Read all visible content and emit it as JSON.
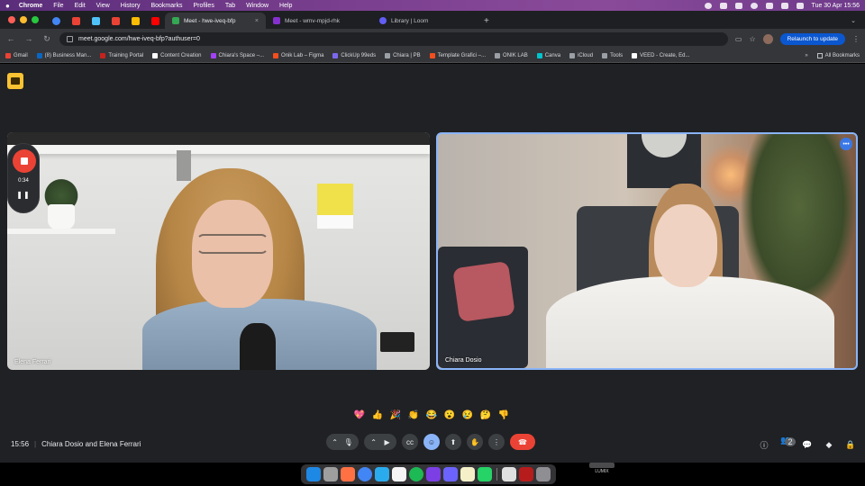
{
  "menubar": {
    "app": "Chrome",
    "items": [
      "File",
      "Edit",
      "View",
      "History",
      "Bookmarks",
      "Profiles",
      "Tab",
      "Window",
      "Help"
    ],
    "datetime": "Tue 30 Apr  15:56"
  },
  "tabs": [
    {
      "label": "Meet - hwe-iveq-bfp",
      "active": true,
      "color": "#34a853"
    },
    {
      "label": "Meet - wmv-mpjd-rhk",
      "active": false,
      "color": "#8430ce"
    },
    {
      "label": "Library | Loom",
      "active": false,
      "color": "#625df5"
    }
  ],
  "toolbar": {
    "url": "meet.google.com/hwe-iveq-bfp?authuser=0",
    "relaunch_label": "Relaunch to update"
  },
  "bookmarks": {
    "items": [
      {
        "label": "Gmail",
        "color": "#ea4335"
      },
      {
        "label": "(8) Business Man...",
        "color": "#0a66c2"
      },
      {
        "label": "Training Portal",
        "color": "#c5221f"
      },
      {
        "label": "Content Creation",
        "color": "#ffffff"
      },
      {
        "label": "Chiara's Space –...",
        "color": "#a142f4"
      },
      {
        "label": "Onik Lab – Figma",
        "color": "#f24e1e"
      },
      {
        "label": "ClickUp 99eds",
        "color": "#7b68ee"
      },
      {
        "label": "Chiara | PB",
        "color": "#9aa0a6"
      },
      {
        "label": "Template Grafici –...",
        "color": "#f24e1e"
      },
      {
        "label": "ONIK LAB",
        "color": "#9aa0a6"
      },
      {
        "label": "Canva",
        "color": "#00c4cc"
      },
      {
        "label": "iCloud",
        "color": "#9aa0a6"
      },
      {
        "label": "Tools",
        "color": "#9aa0a6"
      },
      {
        "label": "VEED - Create, Ed...",
        "color": "#ffffff"
      }
    ],
    "all_label": "All Bookmarks"
  },
  "recording": {
    "elapsed": "0:34"
  },
  "participants": {
    "left": {
      "name": "Elena Ferrari"
    },
    "right": {
      "name": "Chiara Dosio"
    }
  },
  "reactions": [
    "💖",
    "👍",
    "🎉",
    "👏",
    "😂",
    "😮",
    "😢",
    "🤔",
    "👎"
  ],
  "meeting": {
    "time": "15:56",
    "title": "Chiara Dosio and Elena Ferrari",
    "participant_count": "2"
  },
  "dock": {
    "device_label": "LUMIX"
  },
  "colors": {
    "accent": "#8ab4f8",
    "end_call": "#ea4335",
    "record": "#ea4335",
    "meet_bg": "#202124"
  }
}
